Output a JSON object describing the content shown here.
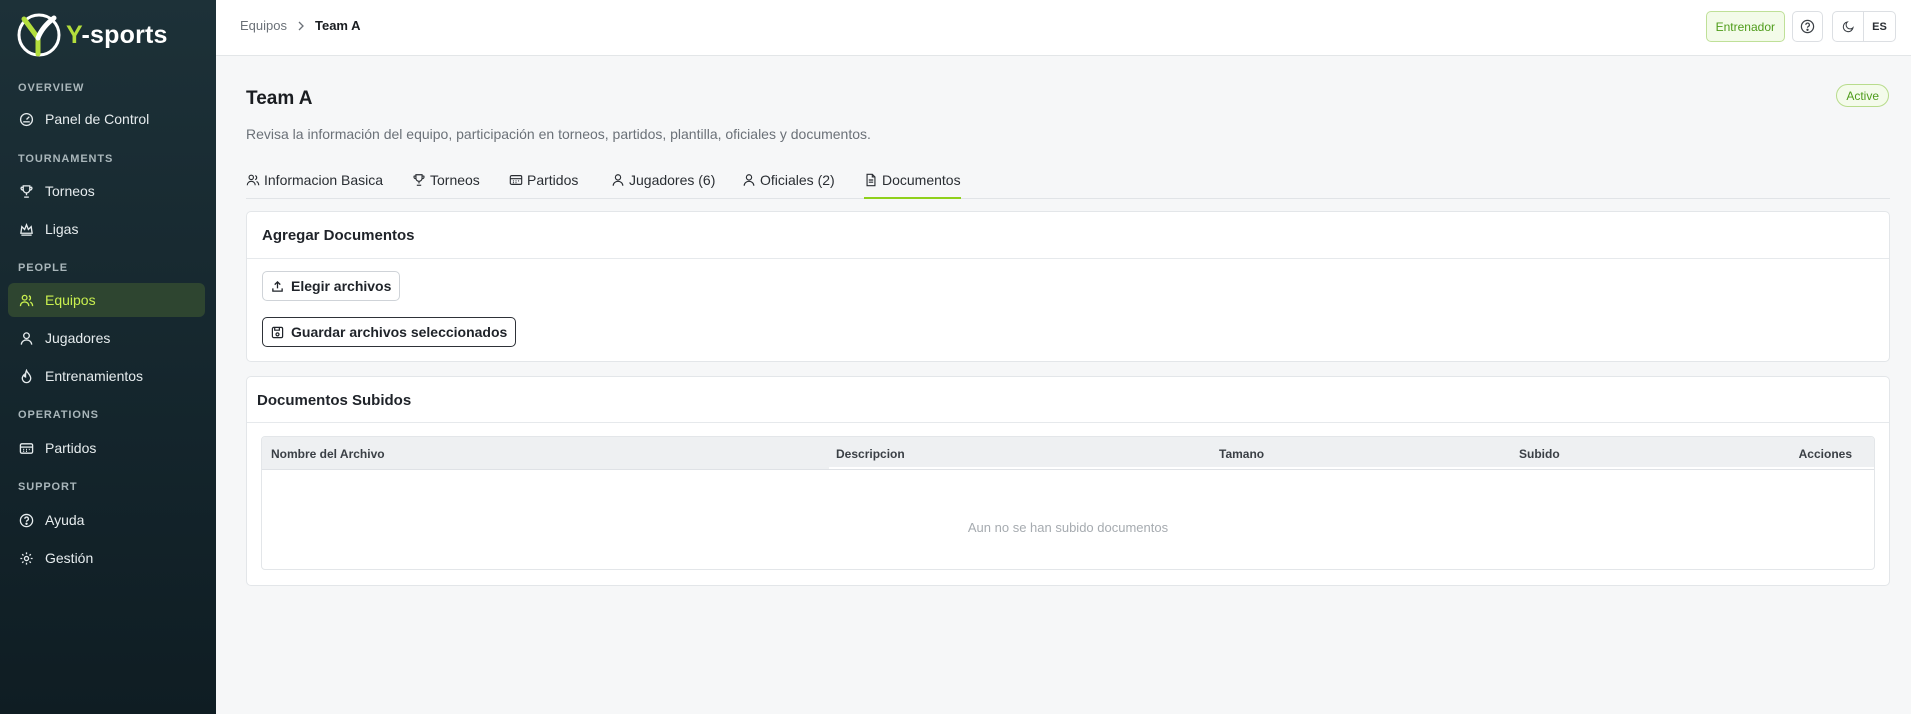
{
  "brand": {
    "name_prefix": "Y",
    "name_suffix": "-sports"
  },
  "sidebar": {
    "sections": {
      "overview": "OVERVIEW",
      "tournaments": "TOURNAMENTS",
      "people": "PEOPLE",
      "operations": "OPERATIONS",
      "support": "SUPPORT"
    },
    "items": {
      "panel": "Panel de Control",
      "torneos": "Torneos",
      "ligas": "Ligas",
      "equipos": "Equipos",
      "jugadores": "Jugadores",
      "entrenamientos": "Entrenamientos",
      "partidos": "Partidos",
      "ayuda": "Ayuda",
      "gestion": "Gestión"
    },
    "active": "equipos"
  },
  "topbar": {
    "breadcrumb": {
      "parent": "Equipos",
      "current": "Team A"
    },
    "role": "Entrenador",
    "language": "ES"
  },
  "page": {
    "title": "Team A",
    "status": "Active",
    "subtitle": "Revisa la información del equipo, participación en torneos, partidos, plantilla, oficiales y documentos."
  },
  "tabs": {
    "basic": "Informacion Basica",
    "torneos": "Torneos",
    "partidos": "Partidos",
    "jugadores": "Jugadores (6)",
    "oficiales": "Oficiales (2)",
    "documentos": "Documentos",
    "active": "documentos"
  },
  "upload": {
    "title": "Agregar Documentos",
    "choose_label": "Elegir archivos",
    "save_label": "Guardar archivos seleccionados"
  },
  "documents": {
    "title": "Documentos Subidos",
    "columns": {
      "name": "Nombre del Archivo",
      "description": "Descripcion",
      "size": "Tamano",
      "uploaded": "Subido",
      "actions": "Acciones"
    },
    "rows": [],
    "empty_message": "Aun no se han subido documentos"
  },
  "colors": {
    "accent": "#8fd01b",
    "sidebar_bg": "#1a2d34",
    "active_item_bg": "#2e4530",
    "active_item_text": "#c9ef4f",
    "status_green": "#4f9c1b"
  }
}
